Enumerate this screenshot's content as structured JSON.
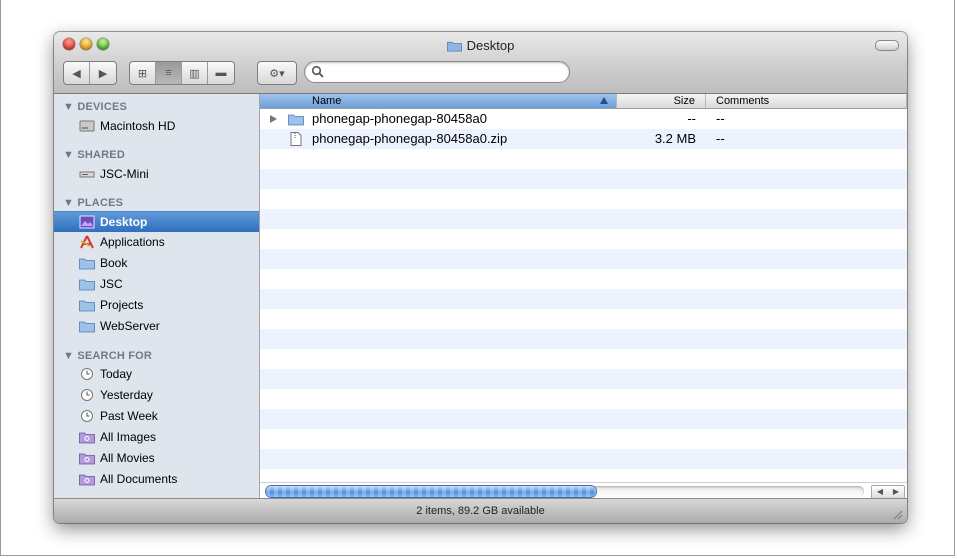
{
  "window": {
    "title": "Desktop",
    "status": "2 items, 89.2 GB available"
  },
  "toolbar": {
    "back_glyph": "◀",
    "forward_glyph": "▶",
    "icon_view_glyph": "⊞",
    "list_view_glyph": "≡",
    "column_view_glyph": "▥",
    "coverflow_glyph": "▬",
    "action_glyph": "⚙▾",
    "search_placeholder": ""
  },
  "sidebar": {
    "sections": [
      {
        "header": "▼ DEVICES",
        "items": [
          {
            "label": "Macintosh HD",
            "icon": "hard-disk-icon"
          }
        ]
      },
      {
        "header": "▼ SHARED",
        "items": [
          {
            "label": "JSC-Mini",
            "icon": "network-computer-icon"
          }
        ]
      },
      {
        "header": "▼ PLACES",
        "items": [
          {
            "label": "Desktop",
            "icon": "desktop-icon",
            "selected": true
          },
          {
            "label": "Applications",
            "icon": "applications-icon"
          },
          {
            "label": "Book",
            "icon": "folder-icon"
          },
          {
            "label": "JSC",
            "icon": "folder-icon"
          },
          {
            "label": "Projects",
            "icon": "folder-icon"
          },
          {
            "label": "WebServer",
            "icon": "folder-icon"
          }
        ]
      },
      {
        "header": "▼ SEARCH FOR",
        "items": [
          {
            "label": "Today",
            "icon": "clock-icon"
          },
          {
            "label": "Yesterday",
            "icon": "clock-icon"
          },
          {
            "label": "Past Week",
            "icon": "clock-icon"
          },
          {
            "label": "All Images",
            "icon": "smart-folder-icon"
          },
          {
            "label": "All Movies",
            "icon": "smart-folder-icon"
          },
          {
            "label": "All Documents",
            "icon": "smart-folder-icon"
          }
        ]
      }
    ]
  },
  "list": {
    "columns": {
      "name": "Name",
      "size": "Size",
      "comments": "Comments"
    },
    "rows": [
      {
        "name": "phonegap-phonegap-80458a0",
        "size": "--",
        "comments": "--",
        "kind": "folder"
      },
      {
        "name": "phonegap-phonegap-80458a0.zip",
        "size": "3.2 MB",
        "comments": "--",
        "kind": "file"
      }
    ]
  },
  "colors": {
    "selection": "#2e6fbf",
    "sidebar_bg": "#dfe5ed",
    "stripe": "#edf3fe"
  }
}
